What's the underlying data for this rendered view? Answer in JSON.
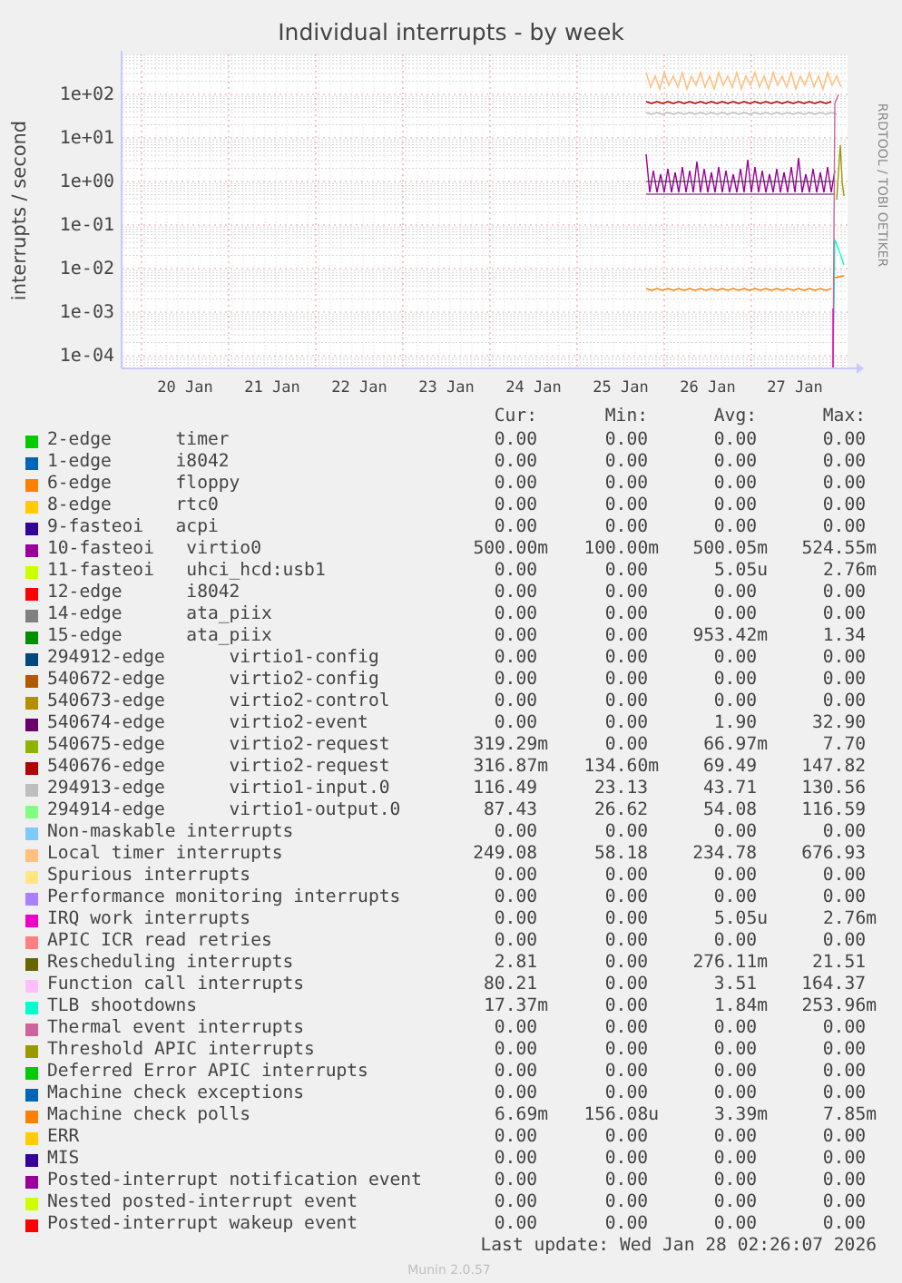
{
  "graph": {
    "title": "Individual interrupts - by week",
    "y_axis_label": "interrupts / second",
    "credit": "RRDTOOL / TOBI OETIKER",
    "y_ticks": [
      "1e+02",
      "1e+01",
      "1e+00",
      "1e-01",
      "1e-02",
      "1e-03",
      "1e-04"
    ],
    "x_ticks": [
      "20 Jan",
      "21 Jan",
      "22 Jan",
      "23 Jan",
      "24 Jan",
      "25 Jan",
      "26 Jan",
      "27 Jan"
    ]
  },
  "legend": {
    "columns": [
      "Cur:",
      "Min:",
      "Avg:",
      "Max:"
    ],
    "rows": [
      {
        "color": "#00cc00",
        "name": "2-edge      timer",
        "cur": "0.00",
        "min": "0.00",
        "avg": "0.00",
        "max": "0.00"
      },
      {
        "color": "#0066b3",
        "name": "1-edge      i8042",
        "cur": "0.00",
        "min": "0.00",
        "avg": "0.00",
        "max": "0.00"
      },
      {
        "color": "#ff8000",
        "name": "6-edge      floppy",
        "cur": "0.00",
        "min": "0.00",
        "avg": "0.00",
        "max": "0.00"
      },
      {
        "color": "#ffcc00",
        "name": "8-edge      rtc0",
        "cur": "0.00",
        "min": "0.00",
        "avg": "0.00",
        "max": "0.00"
      },
      {
        "color": "#330099",
        "name": "9-fasteoi   acpi",
        "cur": "0.00",
        "min": "0.00",
        "avg": "0.00",
        "max": "0.00"
      },
      {
        "color": "#990099",
        "name": "10-fasteoi   virtio0",
        "cur": "500.00m",
        "min": "100.00m",
        "avg": "500.05m",
        "max": "524.55m"
      },
      {
        "color": "#ccff00",
        "name": "11-fasteoi   uhci_hcd:usb1",
        "cur": "0.00",
        "min": "0.00",
        "avg": "5.05u",
        "max": "2.76m"
      },
      {
        "color": "#ff0000",
        "name": "12-edge      i8042",
        "cur": "0.00",
        "min": "0.00",
        "avg": "0.00",
        "max": "0.00"
      },
      {
        "color": "#808080",
        "name": "14-edge      ata_piix",
        "cur": "0.00",
        "min": "0.00",
        "avg": "0.00",
        "max": "0.00"
      },
      {
        "color": "#008f00",
        "name": "15-edge      ata_piix",
        "cur": "0.00",
        "min": "0.00",
        "avg": "953.42m",
        "max": "1.34"
      },
      {
        "color": "#00487d",
        "name": "294912-edge      virtio1-config",
        "cur": "0.00",
        "min": "0.00",
        "avg": "0.00",
        "max": "0.00"
      },
      {
        "color": "#b35a00",
        "name": "540672-edge      virtio2-config",
        "cur": "0.00",
        "min": "0.00",
        "avg": "0.00",
        "max": "0.00"
      },
      {
        "color": "#b38f00",
        "name": "540673-edge      virtio2-control",
        "cur": "0.00",
        "min": "0.00",
        "avg": "0.00",
        "max": "0.00"
      },
      {
        "color": "#6b006b",
        "name": "540674-edge      virtio2-event",
        "cur": "0.00",
        "min": "0.00",
        "avg": "1.90",
        "max": "32.90"
      },
      {
        "color": "#8fb300",
        "name": "540675-edge      virtio2-request",
        "cur": "319.29m",
        "min": "0.00",
        "avg": "66.97m",
        "max": "7.70"
      },
      {
        "color": "#b30000",
        "name": "540676-edge      virtio2-request",
        "cur": "316.87m",
        "min": "134.60m",
        "avg": "69.49",
        "max": "147.82"
      },
      {
        "color": "#bebebe",
        "name": "294913-edge      virtio1-input.0",
        "cur": "116.49",
        "min": "23.13",
        "avg": "43.71",
        "max": "130.56"
      },
      {
        "color": "#80ff80",
        "name": "294914-edge      virtio1-output.0",
        "cur": "87.43",
        "min": "26.62",
        "avg": "54.08",
        "max": "116.59"
      },
      {
        "color": "#80c9ff",
        "name": "Non-maskable interrupts",
        "cur": "0.00",
        "min": "0.00",
        "avg": "0.00",
        "max": "0.00"
      },
      {
        "color": "#ffc080",
        "name": "Local timer interrupts",
        "cur": "249.08",
        "min": "58.18",
        "avg": "234.78",
        "max": "676.93"
      },
      {
        "color": "#ffe680",
        "name": "Spurious interrupts",
        "cur": "0.00",
        "min": "0.00",
        "avg": "0.00",
        "max": "0.00"
      },
      {
        "color": "#aa80ff",
        "name": "Performance monitoring interrupts",
        "cur": "0.00",
        "min": "0.00",
        "avg": "0.00",
        "max": "0.00"
      },
      {
        "color": "#ee00cc",
        "name": "IRQ work interrupts",
        "cur": "0.00",
        "min": "0.00",
        "avg": "5.05u",
        "max": "2.76m"
      },
      {
        "color": "#ff8080",
        "name": "APIC ICR read retries",
        "cur": "0.00",
        "min": "0.00",
        "avg": "0.00",
        "max": "0.00"
      },
      {
        "color": "#666600",
        "name": "Rescheduling interrupts",
        "cur": "2.81",
        "min": "0.00",
        "avg": "276.11m",
        "max": "21.51"
      },
      {
        "color": "#ffbfff",
        "name": "Function call interrupts",
        "cur": "80.21",
        "min": "0.00",
        "avg": "3.51",
        "max": "164.37"
      },
      {
        "color": "#00ffcc",
        "name": "TLB shootdowns",
        "cur": "17.37m",
        "min": "0.00",
        "avg": "1.84m",
        "max": "253.96m"
      },
      {
        "color": "#cc6699",
        "name": "Thermal event interrupts",
        "cur": "0.00",
        "min": "0.00",
        "avg": "0.00",
        "max": "0.00"
      },
      {
        "color": "#999900",
        "name": "Threshold APIC interrupts",
        "cur": "0.00",
        "min": "0.00",
        "avg": "0.00",
        "max": "0.00"
      },
      {
        "color": "#00cc00",
        "name": "Deferred Error APIC interrupts",
        "cur": "0.00",
        "min": "0.00",
        "avg": "0.00",
        "max": "0.00"
      },
      {
        "color": "#0066b3",
        "name": "Machine check exceptions",
        "cur": "0.00",
        "min": "0.00",
        "avg": "0.00",
        "max": "0.00"
      },
      {
        "color": "#ff8000",
        "name": "Machine check polls",
        "cur": "6.69m",
        "min": "156.08u",
        "avg": "3.39m",
        "max": "7.85m"
      },
      {
        "color": "#ffcc00",
        "name": "ERR",
        "cur": "0.00",
        "min": "0.00",
        "avg": "0.00",
        "max": "0.00"
      },
      {
        "color": "#330099",
        "name": "MIS",
        "cur": "0.00",
        "min": "0.00",
        "avg": "0.00",
        "max": "0.00"
      },
      {
        "color": "#990099",
        "name": "Posted-interrupt notification event",
        "cur": "0.00",
        "min": "0.00",
        "avg": "0.00",
        "max": "0.00"
      },
      {
        "color": "#ccff00",
        "name": "Nested posted-interrupt event",
        "cur": "0.00",
        "min": "0.00",
        "avg": "0.00",
        "max": "0.00"
      },
      {
        "color": "#ff0000",
        "name": "Posted-interrupt wakeup event",
        "cur": "0.00",
        "min": "0.00",
        "avg": "0.00",
        "max": "0.00"
      }
    ]
  },
  "last_update": "Last update: Wed Jan 28 02:26:07 2026",
  "footer": "Munin 2.0.57"
}
